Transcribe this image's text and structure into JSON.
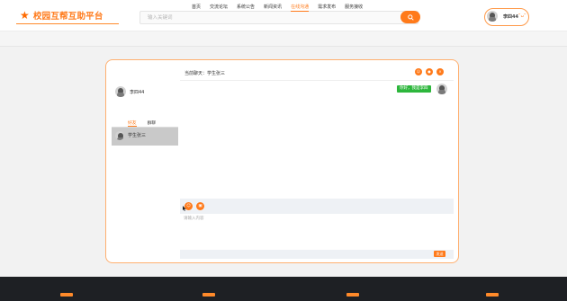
{
  "header": {
    "logo_text": "校园互帮互助平台",
    "search_placeholder": "输入关键词",
    "username": "李四44"
  },
  "nav": {
    "items": [
      "首页",
      "交流论坛",
      "系统公告",
      "新闻资讯",
      "在线沟通",
      "需求发布",
      "服务接收"
    ],
    "active_index": 4
  },
  "left": {
    "me_name": "李四44",
    "tabs": [
      "好友",
      "群聊"
    ],
    "active_tab": 0,
    "friends": [
      {
        "name": "学生张三"
      }
    ]
  },
  "chat": {
    "title": "当前聊天：学生张三",
    "messages": [
      {
        "text": "你好，我是李四",
        "from": "me"
      }
    ],
    "input_placeholder": "请输入内容",
    "send_label": "发送"
  },
  "colors": {
    "accent": "#ff7a1a",
    "message_bubble": "#2db63c",
    "footer": "#1e2024"
  }
}
